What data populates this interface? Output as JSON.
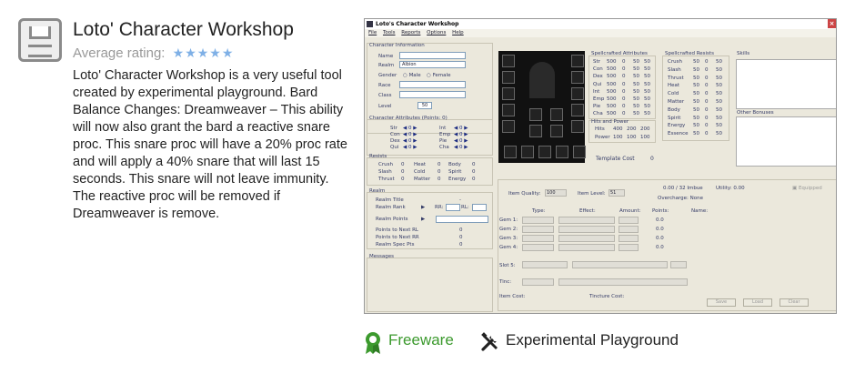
{
  "app": {
    "title": "Loto' Character Workshop",
    "rating_label": "Average rating:",
    "stars": "★★★★★",
    "description": "Loto' Character Workshop is a very useful tool created by experimental playground. Bard Balance Changes: Dreamweaver – This ability will now also grant the bard a reactive snare proc. This snare proc will have a 20% proc rate and will apply a 40% snare that will last 15 seconds. This snare will not leave immunity. The reactive proc will be removed if Dreamweaver is remove."
  },
  "footer": {
    "license": "Freeware",
    "developer": "Experimental Playground",
    "license_color": "#3c9a2e"
  },
  "screenshot": {
    "window_title": "Loto's Character Workshop",
    "menu": [
      "File",
      "Tools",
      "Reports",
      "Options",
      "Help"
    ],
    "character_info": {
      "header": "Character Information",
      "name_label": "Name",
      "realm_label": "Realm",
      "realm_value": "Albion",
      "gender_label": "Gender",
      "male": "Male",
      "female": "Female",
      "race_label": "Race",
      "class_label": "Class",
      "level_label": "Level",
      "level_value": "50"
    },
    "attributes": {
      "header": "Character Attributes (Points: 0)",
      "left": [
        [
          "Str",
          "0"
        ],
        [
          "Con",
          "0"
        ],
        [
          "Dex",
          "0"
        ],
        [
          "Qui",
          "0"
        ]
      ],
      "right": [
        [
          "Int",
          "0"
        ],
        [
          "Emp",
          "0"
        ],
        [
          "Pie",
          "0"
        ],
        [
          "Cha",
          "0"
        ]
      ]
    },
    "resists": {
      "header": "Resists",
      "rows": [
        [
          "Crush",
          "0",
          "Heat",
          "0",
          "Body",
          "0"
        ],
        [
          "Slash",
          "0",
          "Cold",
          "0",
          "Spirit",
          "0"
        ],
        [
          "Thrust",
          "0",
          "Matter",
          "0",
          "Energy",
          "0"
        ]
      ]
    },
    "realm": {
      "header": "Realm",
      "title_label": "Realm Title",
      "title_value": "-",
      "rank_label": "Realm Rank",
      "rr_label": "RR:",
      "rl_label": "RL:",
      "points_label": "Realm Points",
      "next_rl_label": "Points to Next RL",
      "next_rl_value": "0",
      "next_rr_label": "Points to Next RR",
      "next_rr_value": "0",
      "spec_label": "Realm Spec Pts",
      "spec_value": "0"
    },
    "messages_header": "Messages",
    "spellcrafted_attributes": {
      "header": "Spellcrafted Attributes",
      "rows": [
        [
          "Str",
          "500",
          "0",
          "50",
          "50"
        ],
        [
          "Con",
          "500",
          "0",
          "50",
          "50"
        ],
        [
          "Dex",
          "500",
          "0",
          "50",
          "50"
        ],
        [
          "Qui",
          "500",
          "0",
          "50",
          "50"
        ],
        [
          "Int",
          "500",
          "0",
          "50",
          "50"
        ],
        [
          "Emp",
          "500",
          "0",
          "50",
          "50"
        ],
        [
          "Pie",
          "500",
          "0",
          "50",
          "50"
        ],
        [
          "Cha",
          "500",
          "0",
          "50",
          "50"
        ]
      ]
    },
    "hits_power": {
      "header": "Hits and Power",
      "rows": [
        [
          "Hits",
          "400",
          "200",
          "200"
        ],
        [
          "Power",
          "100",
          "100",
          "100"
        ]
      ]
    },
    "spellcrafted_resists": {
      "header": "Spellcrafted Resists",
      "rows": [
        [
          "Crush",
          "50",
          "0",
          "50"
        ],
        [
          "Slash",
          "50",
          "0",
          "50"
        ],
        [
          "Thrust",
          "50",
          "0",
          "50"
        ],
        [
          "Heat",
          "50",
          "0",
          "50"
        ],
        [
          "Cold",
          "50",
          "0",
          "50"
        ],
        [
          "Matter",
          "50",
          "0",
          "50"
        ],
        [
          "Body",
          "50",
          "0",
          "50"
        ],
        [
          "Spirit",
          "50",
          "0",
          "50"
        ],
        [
          "Energy",
          "50",
          "0",
          "50"
        ],
        [
          "Essence",
          "50",
          "0",
          "50"
        ]
      ]
    },
    "skills_header": "Skills",
    "other_bonuses_header": "Other Bonuses",
    "template_cost_label": "Template Cost",
    "template_cost_value": "0",
    "item": {
      "quality_label": "Item Quality:",
      "quality_value": "100",
      "level_label": "Item Level:",
      "level_value": "51",
      "imbue": "0.00 / 32 Imbue",
      "utility": "Utility: 0.00",
      "equipped": "Equipped",
      "overcharge": "Overcharge: None",
      "col_type": "Type:",
      "col_effect": "Effect:",
      "col_amount": "Amount:",
      "col_points": "Points:",
      "col_name": "Name:",
      "gems": [
        [
          "Gem 1:",
          "0.0"
        ],
        [
          "Gem 2:",
          "0.0"
        ],
        [
          "Gem 3:",
          "0.0"
        ],
        [
          "Gem 4:",
          "0.0"
        ]
      ],
      "slot5": "Slot 5:",
      "tinc": "Tinc:",
      "item_cost": "Item Cost:",
      "tincture_cost": "Tincture Cost:",
      "save": "Save",
      "load": "Load",
      "clear": "Clear"
    }
  }
}
